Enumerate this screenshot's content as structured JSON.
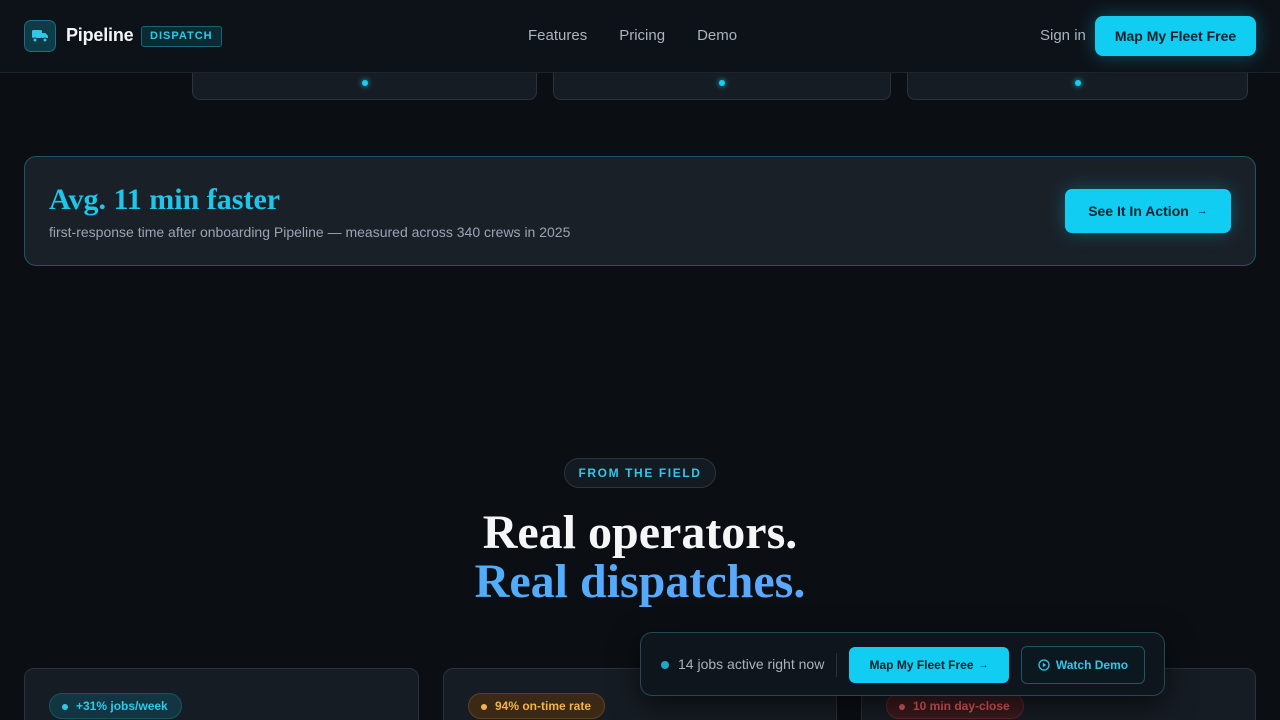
{
  "nav": {
    "brand": "Pipeline",
    "brand_tag": "DISPATCH",
    "links": [
      "Features",
      "Pricing",
      "Demo"
    ],
    "sign_in": "Sign in",
    "cta": "Map My Fleet Free"
  },
  "banner": {
    "title": "Avg. 11 min faster",
    "subtitle": "first-response time after onboarding Pipeline — measured across 340 crews in 2025",
    "button": "See It In Action",
    "button_arrow": "→"
  },
  "section": {
    "eyebrow": "FROM THE FIELD",
    "headline_line1": "Real operators.",
    "headline_line2": "Real dispatches."
  },
  "testimonials": [
    {
      "badge": "+31% jobs/week"
    },
    {
      "badge": "94% on-time rate"
    },
    {
      "badge": "10 min day-close"
    }
  ],
  "floatbar": {
    "status": "14 jobs active right now",
    "cta": "Map My Fleet Free",
    "cta_arrow": "→",
    "demo": "Watch Demo"
  },
  "colors": {
    "accent": "#11cdf2",
    "background": "#0b0f14",
    "amber": "#f3b24a",
    "red": "#e05a5e"
  },
  "icons": {
    "logo": "truck-icon",
    "demo": "play-circle-icon"
  }
}
